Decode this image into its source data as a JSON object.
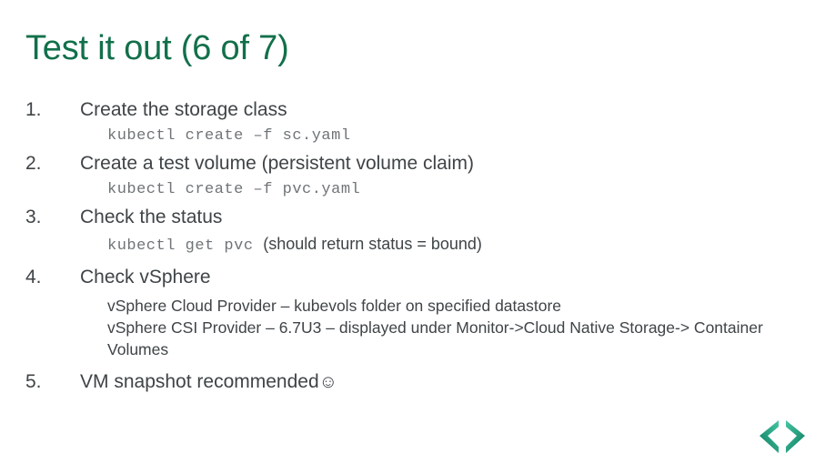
{
  "slide": {
    "title": "Test it out (6 of 7)",
    "title_color": "#12704a",
    "background_color": "#ffffff",
    "body_text_color": "#3f4447",
    "code_text_color": "#6f7477"
  },
  "items": [
    {
      "number": "1.",
      "title": "Create the storage class",
      "code": "kubectl create –f sc.yaml",
      "note": ""
    },
    {
      "number": "2.",
      "title": "Create a test volume (persistent volume claim)",
      "code": "kubectl create –f pvc.yaml",
      "note": ""
    },
    {
      "number": "3.",
      "title": "Check the status",
      "code": "kubectl get pvc ",
      "note": "(should return status = bound)"
    },
    {
      "number": "4.",
      "title": "Check vSphere",
      "sub_lines": [
        "vSphere Cloud Provider – kubevols folder on specified datastore",
        "vSphere CSI Provider – 6.7U3 – displayed under Monitor->Cloud Native Storage-> Container Volumes"
      ]
    },
    {
      "number": "5.",
      "title": "VM snapshot recommended",
      "smiley": "☺"
    }
  ],
  "logo": {
    "name": "angle-brackets-logo",
    "left_glyph": "<",
    "right_glyph": ">",
    "color_dark": "#0e7a5f",
    "color_light": "#3fc1a0"
  }
}
